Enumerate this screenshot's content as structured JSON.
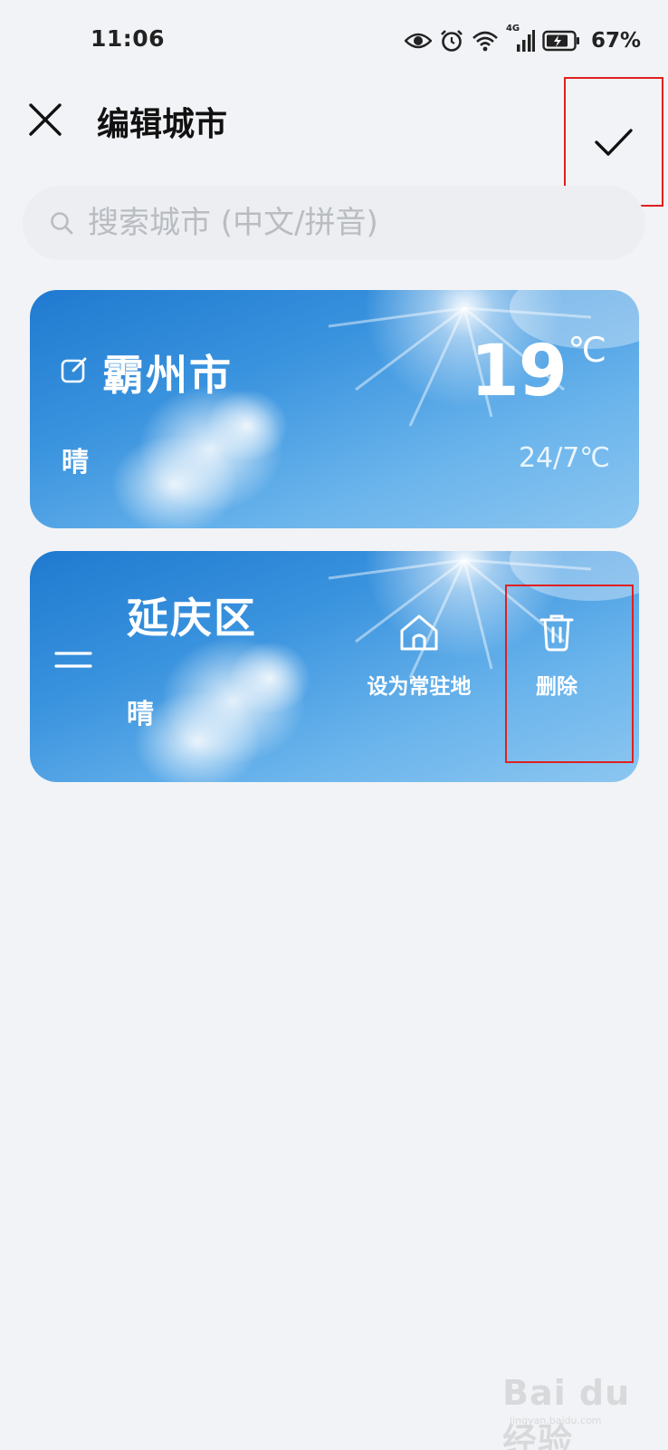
{
  "status_bar": {
    "time": "11:06",
    "network": "4G",
    "battery": "67%"
  },
  "header": {
    "title": "编辑城市",
    "close_icon": "close-icon",
    "confirm_icon": "check-icon"
  },
  "search": {
    "placeholder": "搜索城市 (中文/拼音)",
    "value": ""
  },
  "cities": [
    {
      "name": "霸州市",
      "weather": "晴",
      "temperature": "19",
      "unit": "℃",
      "range": "24/7℃"
    },
    {
      "name": "延庆区",
      "weather": "晴",
      "actions": {
        "set_home": "设为常驻地",
        "delete": "删除"
      }
    }
  ],
  "colors": {
    "background": "#f2f3f6",
    "card_blue": "#2a86d6",
    "highlight": "#e02020"
  },
  "watermark": "Bai du 经验",
  "watermark_sub": "jingyan.baidu.com"
}
